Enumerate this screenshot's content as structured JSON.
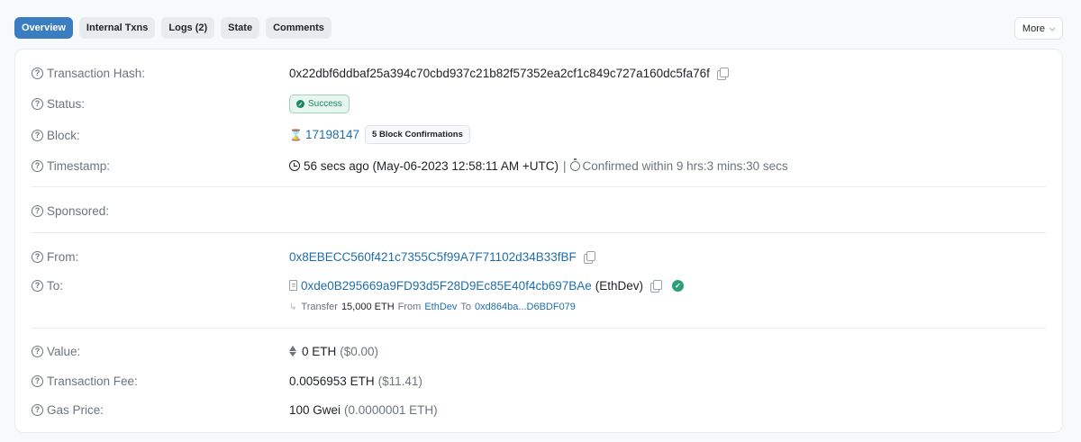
{
  "tabs": [
    {
      "label": "Overview",
      "active": true
    },
    {
      "label": "Internal Txns"
    },
    {
      "label": "Logs (2)"
    },
    {
      "label": "State"
    },
    {
      "label": "Comments"
    }
  ],
  "more_label": "More",
  "details": {
    "tx_hash_label": "Transaction Hash:",
    "tx_hash": "0x22dbf6ddbaf25a394c70cbd937c21b82f57352ea2cf1c849c727a160dc5fa76f",
    "status_label": "Status:",
    "status": "Success",
    "block_label": "Block:",
    "block": "17198147",
    "block_confirmations": "5 Block Confirmations",
    "timestamp_label": "Timestamp:",
    "timestamp": "56 secs ago (May-06-2023 12:58:11 AM +UTC)",
    "timestamp_sep": "|",
    "confirmed": "Confirmed within 9 hrs:3 mins:30 secs",
    "sponsored_label": "Sponsored:",
    "from_label": "From:",
    "from": "0x8EBECC560f421c7355C5f99A7F71102d34B33fBF",
    "to_label": "To:",
    "to": "0xde0B295669a9FD93d5F28D9Ec85E40f4cb697BAe",
    "to_name": "(EthDev)",
    "transfer_word": "Transfer",
    "transfer_amount": "15,000 ETH",
    "from_word": "From",
    "transfer_from": "EthDev",
    "to_word": "To",
    "transfer_to": "0xd864ba...D6BDF079",
    "value_label": "Value:",
    "value": "0 ETH",
    "value_usd": "($0.00)",
    "fee_label": "Transaction Fee:",
    "fee": "0.0056953 ETH",
    "fee_usd": "($11.41)",
    "gas_label": "Gas Price:",
    "gas": "100 Gwei",
    "gas_eth": "(0.0000001 ETH)"
  },
  "colors": {
    "accent": "#3a7ec1",
    "link": "#1f6ea9",
    "success": "#178a64"
  }
}
